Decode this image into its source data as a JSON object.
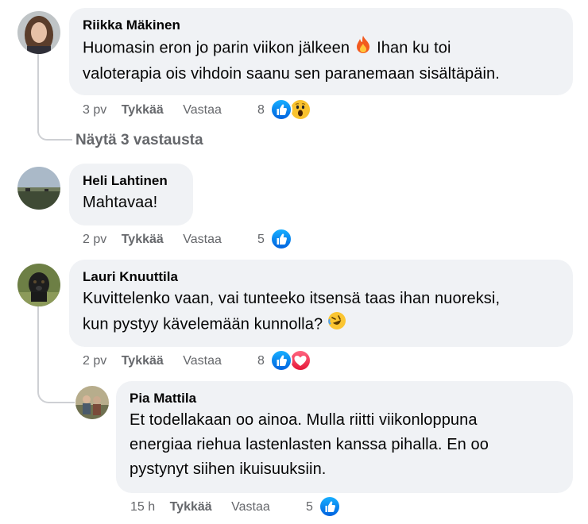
{
  "comments": [
    {
      "author": "Riikka Mäkinen",
      "text_part1": "Huomasin eron jo parin viikon jälkeen",
      "text_part2": "Ihan ku toi",
      "text_line2": "valoterapia ois vihdoin saanu sen paranemaan sisältäpäin.",
      "time": "3 pv",
      "like_label": "Tykkää",
      "reply_label": "Vastaa",
      "reaction_count": "8",
      "reactions": [
        "like-icon",
        "wow-icon"
      ],
      "inline_emoji": "fire-icon"
    },
    {
      "author": "Heli Lahtinen",
      "text_line1": "Mahtavaa!",
      "time": "2 pv",
      "like_label": "Tykkää",
      "reply_label": "Vastaa",
      "reaction_count": "5",
      "reactions": [
        "like-icon"
      ]
    },
    {
      "author": "Lauri Knuuttila",
      "text_line1": "Kuvittelenko vaan, vai tunteeko itsensä taas ihan nuoreksi,",
      "text_line2": "kun pystyy kävelemään kunnolla?",
      "time": "2 pv",
      "like_label": "Tykkää",
      "reply_label": "Vastaa",
      "reaction_count": "8",
      "reactions": [
        "like-icon",
        "love-icon"
      ],
      "inline_emoji": "rofl-icon"
    },
    {
      "author": "Pia Mattila",
      "text_line1": "Et todellakaan oo ainoa. Mulla riitti viikonloppuna",
      "text_line2": "energiaa riehua lastenlasten kanssa pihalla. En oo",
      "text_line3": "pystynyt siihen ikuisuuksiin.",
      "time": "15 h",
      "like_label": "Tykkää",
      "reply_label": "Vastaa",
      "reaction_count": "5",
      "reactions": [
        "like-icon"
      ]
    }
  ],
  "show_replies": "Näytä 3 vastausta",
  "colors": {
    "bubble": "#f0f2f5",
    "meta_text": "#65676b",
    "like_blue": "#1877f2",
    "love_red": "#f33e58",
    "thread_line": "#ced0d4"
  }
}
